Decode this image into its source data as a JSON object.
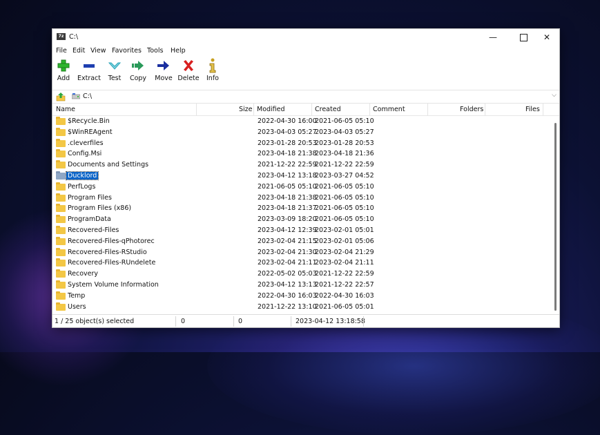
{
  "window": {
    "title": "C:\\",
    "icon_text": "7z",
    "controls": {
      "minimize": "—",
      "close": "✕"
    }
  },
  "menu": [
    "File",
    "Edit",
    "View",
    "Favorites",
    "Tools",
    "Help"
  ],
  "toolbar": [
    {
      "label": "Add",
      "icon": "plus-icon",
      "color": "#2fb52f"
    },
    {
      "label": "Extract",
      "icon": "minus-icon",
      "color": "#1e3fb0"
    },
    {
      "label": "Test",
      "icon": "check-icon",
      "color": "#2aa5b8"
    },
    {
      "label": "Copy",
      "icon": "double-arrow-icon",
      "color": "#2a9a5a"
    },
    {
      "label": "Move",
      "icon": "arrow-right-icon",
      "color": "#1b2fa0"
    },
    {
      "label": "Delete",
      "icon": "x-icon",
      "color": "#d82020"
    },
    {
      "label": "Info",
      "icon": "info-icon",
      "color": "#c8a020"
    }
  ],
  "address": {
    "path": "C:\\",
    "dropdown_glyph": "⌵"
  },
  "columns": {
    "name": "Name",
    "size": "Size",
    "modified": "Modified",
    "created": "Created",
    "comment": "Comment",
    "folders": "Folders",
    "files": "Files"
  },
  "rows": [
    {
      "name": "$Recycle.Bin",
      "modified": "2022-04-30 16:00",
      "created": "2021-06-05 05:10",
      "selected": false
    },
    {
      "name": "$WinREAgent",
      "modified": "2023-04-03 05:27",
      "created": "2023-04-03 05:27",
      "selected": false
    },
    {
      "name": ".cleverfiles",
      "modified": "2023-01-28 20:53",
      "created": "2023-01-28 20:53",
      "selected": false
    },
    {
      "name": "Config.Msi",
      "modified": "2023-04-18 21:38",
      "created": "2023-04-18 21:36",
      "selected": false
    },
    {
      "name": "Documents and Settings",
      "modified": "2021-12-22 22:59",
      "created": "2021-12-22 22:59",
      "selected": false
    },
    {
      "name": "Ducklord",
      "modified": "2023-04-12 13:18",
      "created": "2023-03-27 04:52",
      "selected": true
    },
    {
      "name": "PerfLogs",
      "modified": "2021-06-05 05:10",
      "created": "2021-06-05 05:10",
      "selected": false
    },
    {
      "name": "Program Files",
      "modified": "2023-04-18 21:38",
      "created": "2021-06-05 05:10",
      "selected": false
    },
    {
      "name": "Program Files (x86)",
      "modified": "2023-04-18 21:37",
      "created": "2021-06-05 05:10",
      "selected": false
    },
    {
      "name": "ProgramData",
      "modified": "2023-03-09 18:20",
      "created": "2021-06-05 05:10",
      "selected": false
    },
    {
      "name": "Recovered-Files",
      "modified": "2023-04-12 12:39",
      "created": "2023-02-01 05:01",
      "selected": false
    },
    {
      "name": "Recovered-Files-qPhotorec",
      "modified": "2023-02-04 21:15",
      "created": "2023-02-01 05:06",
      "selected": false
    },
    {
      "name": "Recovered-Files-RStudio",
      "modified": "2023-02-04 21:30",
      "created": "2023-02-04 21:29",
      "selected": false
    },
    {
      "name": "Recovered-Files-RUndelete",
      "modified": "2023-02-04 21:11",
      "created": "2023-02-04 21:11",
      "selected": false
    },
    {
      "name": "Recovery",
      "modified": "2022-05-02 05:03",
      "created": "2021-12-22 22:59",
      "selected": false
    },
    {
      "name": "System Volume Information",
      "modified": "2023-04-12 13:13",
      "created": "2021-12-22 22:57",
      "selected": false
    },
    {
      "name": "Temp",
      "modified": "2022-04-30 16:03",
      "created": "2022-04-30 16:03",
      "selected": false
    },
    {
      "name": "Users",
      "modified": "2021-12-22 13:10",
      "created": "2021-06-05 05:01",
      "selected": false
    }
  ],
  "status": {
    "selection": "1 / 25 object(s) selected",
    "size1": "0",
    "size2": "0",
    "timestamp": "2023-04-12 13:18:58"
  },
  "colors": {
    "selection": "#0b64c8",
    "folder": "#f3c745"
  }
}
